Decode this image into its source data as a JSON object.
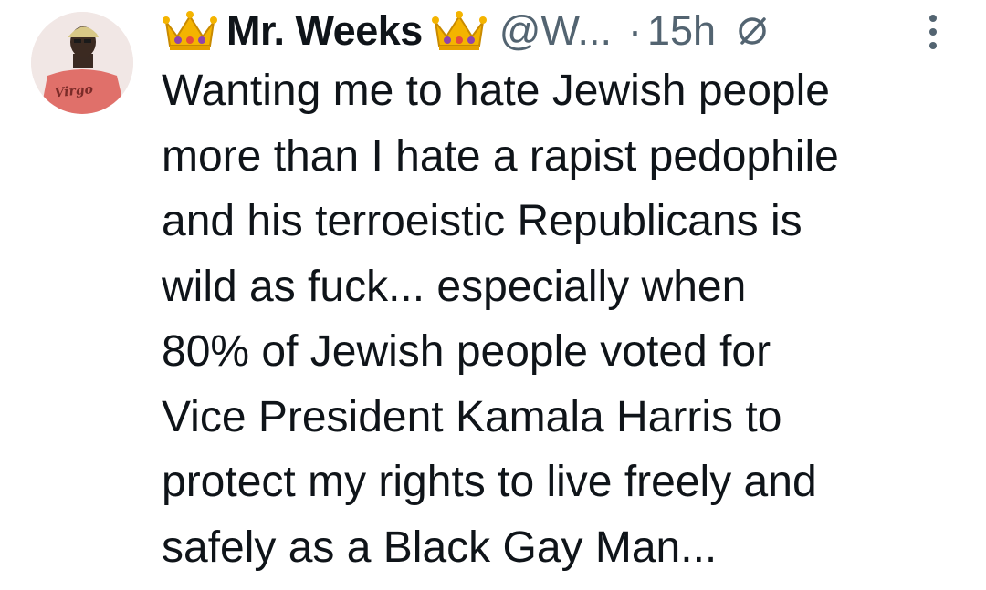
{
  "tweet": {
    "avatar": {
      "shirt_text": "Virgo"
    },
    "author": {
      "display_name": "Mr. Weeks",
      "handle": "@W...",
      "separator": "·",
      "time": "15h"
    },
    "icons": {
      "crown_left": "crown-emoji",
      "crown_right": "crown-emoji",
      "edited": "slashed-circle-icon",
      "more": "vertical-ellipsis-icon"
    },
    "text": "Wanting me to hate Jewish people\nmore than I hate a rapist pedophile\nand his terroeistic Republicans is\nwild as fuck...  especially when\n80% of Jewish people voted for\nVice President Kamala Harris to\nprotect my rights to live freely and\nsafely as a Black Gay Man..."
  },
  "colors": {
    "text_primary": "#0f1419",
    "text_secondary": "#536471",
    "crown_gold": "#f4b400",
    "crown_gem": "#8e44ad"
  }
}
